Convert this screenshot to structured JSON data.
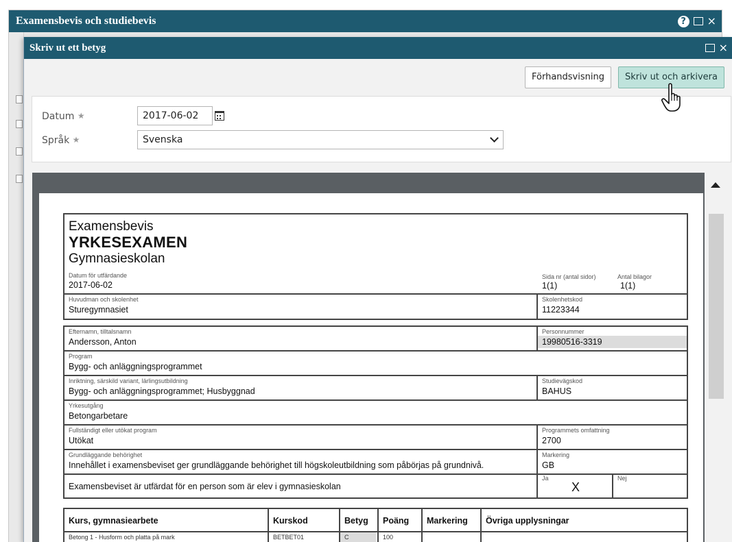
{
  "outer_window": {
    "title": "Examensbevis och studiebevis",
    "help_glyph": "?",
    "maximize_icon": "maximize-icon",
    "close_glyph": "×"
  },
  "dialog": {
    "title": "Skriv ut ett betyg",
    "close_glyph": "×",
    "preview_button": "Förhandsvisning",
    "print_button": "Skriv ut och arkivera"
  },
  "form": {
    "date_label": "Datum",
    "date_value": "2017-06-02",
    "language_label": "Språk",
    "language_value": "Svenska",
    "required_glyph": "★"
  },
  "document": {
    "doc_type": "Examensbevis",
    "exam_title": "YRKESEXAMEN",
    "school_form": "Gymnasieskolan",
    "issue_date_label": "Datum för utfärdande",
    "issue_date": "2017-06-02",
    "page_label": "Sida nr (antal sidor)",
    "page_value": "1(1)",
    "attachments_label": "Antal bilagor",
    "attachments_value": "1(1)",
    "principal_label": "Huvudman och skolenhet",
    "principal_value": "Sturegymnasiet",
    "school_code_label": "Skolenhetskod",
    "school_code_value": "11223344",
    "name_label": "Efternamn, tilltalsnamn",
    "name_value": "Andersson, Anton",
    "pnr_label": "Personnummer",
    "pnr_value": "19980516-3319",
    "program_label": "Program",
    "program_value": "Bygg- och anläggningsprogrammet",
    "orientation_label": "Inriktning, särskild variant, lärlingsutbildning",
    "orientation_value": "Bygg- och anläggningsprogrammet; Husbyggnad",
    "study_path_label": "Studievägskod",
    "study_path_value": "BAHUS",
    "outcome_label": "Yrkesutgång",
    "outcome_value": "Betongarbetare",
    "full_label": "Fullständigt eller utökat program",
    "full_value": "Utökat",
    "scope_label": "Programmets omfattning",
    "scope_value": "2700",
    "eligibility_label": "Grundläggande behörighet",
    "eligibility_value": "Innehållet i examensbeviset ger grundläggande behörighet till högskoleutbildning som påbörjas på grundnivå.",
    "marking_label": "Markering",
    "marking_value": "GB",
    "issued_for_text": "Examensbeviset är utfärdat för en person som är elev i gymnasieskolan",
    "yes_label": "Ja",
    "yes_mark": "X",
    "no_label": "Nej",
    "table_headers": [
      "Kurs, gymnasiearbete",
      "Kurskod",
      "Betyg",
      "Poäng",
      "Markering",
      "Övriga upplysningar"
    ],
    "first_row": [
      "Betong 1 - Husform och platta på mark",
      "BETBET01",
      "C",
      "100"
    ]
  },
  "colors": {
    "titlebar": "#1e5a70",
    "print_button": "#bfe3dc",
    "preview_background": "#5a5f63"
  }
}
